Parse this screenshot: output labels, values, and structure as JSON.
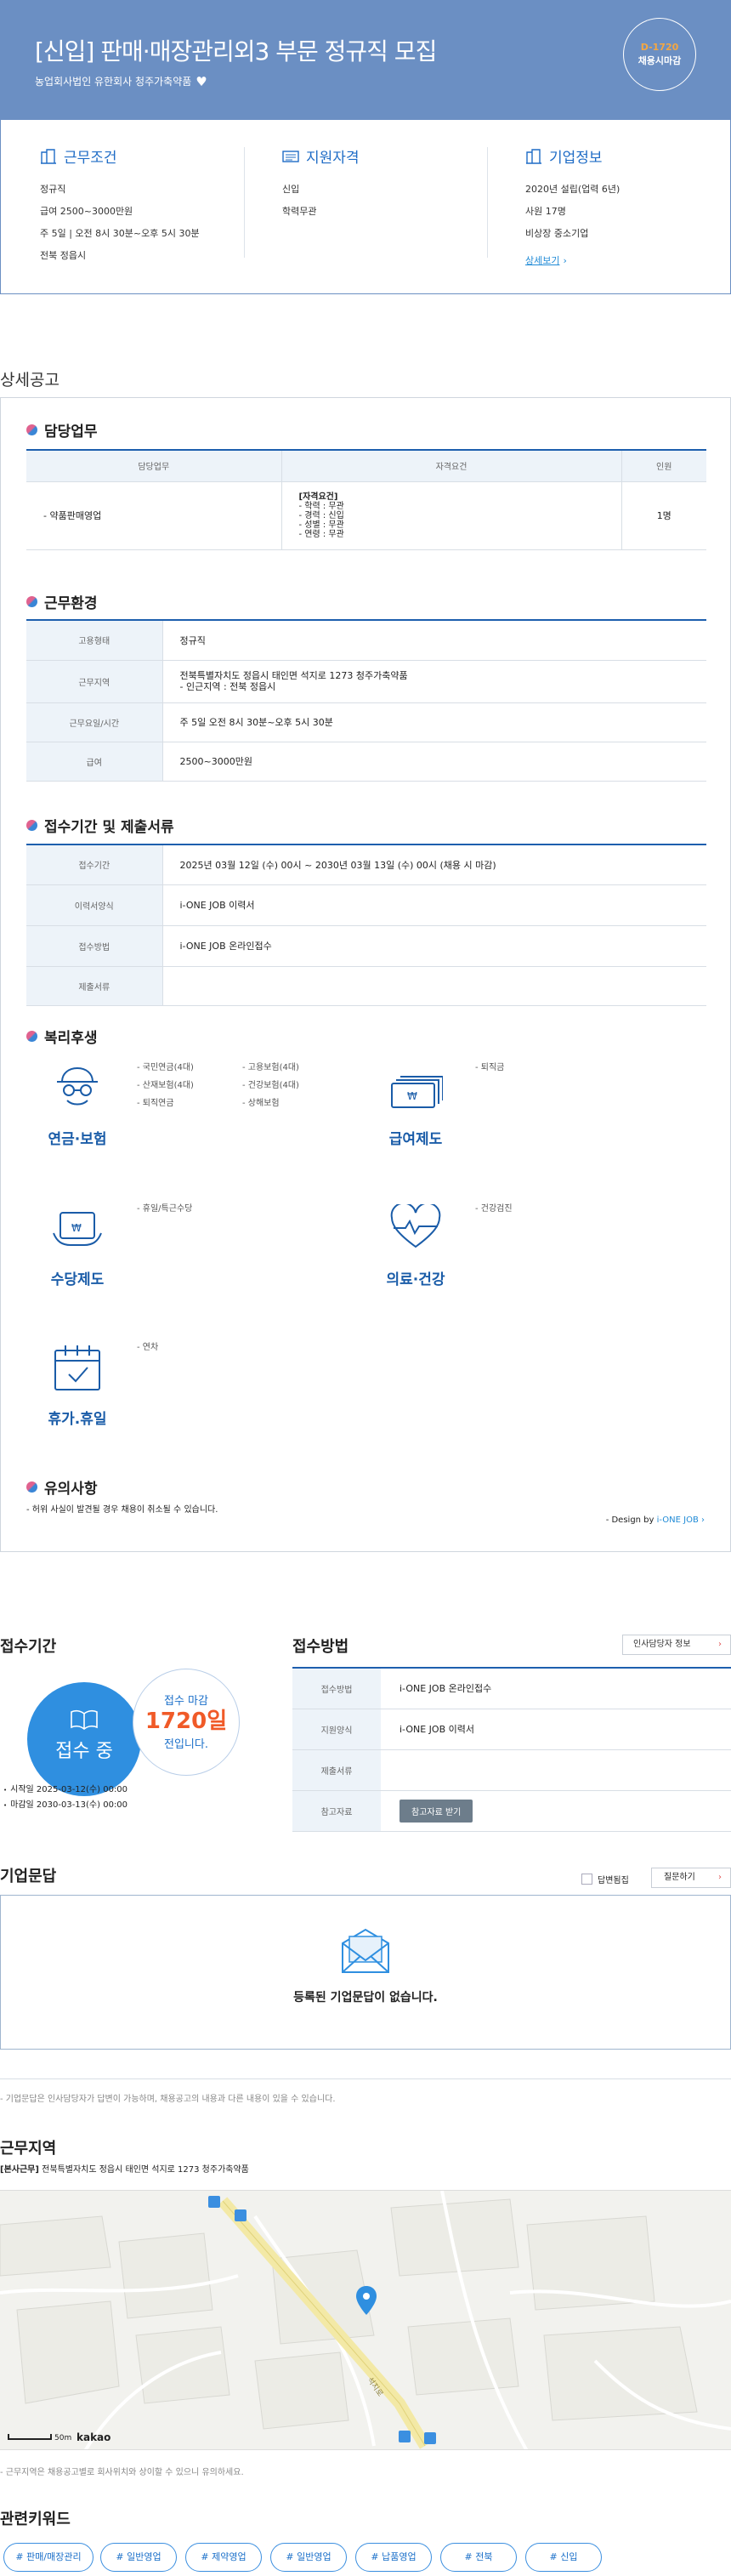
{
  "header": {
    "title": "[신입] 판매·매장관리외3 부문 정규직 모집",
    "company": "농업회사법인 유한회사 청주가축약품",
    "dday": "D-1720",
    "dday_sub": "채용시마감"
  },
  "summary": {
    "conditions": {
      "title": "근무조건",
      "items": [
        "정규직",
        "급여 2500~3000만원",
        "주 5일 | 오전 8시 30분~오후 5시 30분",
        "전북 정읍시"
      ]
    },
    "qualifications": {
      "title": "지원자격",
      "items": [
        "신입",
        "학력무관"
      ]
    },
    "company": {
      "title": "기업정보",
      "items": [
        "2020년 설립(업력 6년)",
        "사원 17명",
        "비상장 중소기업"
      ],
      "more": "상세보기"
    }
  },
  "detail": {
    "title": "상세공고",
    "duties": {
      "title": "담당업무",
      "headers": [
        "담당업무",
        "자격요건",
        "인원"
      ],
      "row": {
        "duty": "- 약품판매영업",
        "req_title": "[자격요건]",
        "reqs": [
          "- 학력 : 무관",
          "- 경력 : 신입",
          "- 성별 : 무관",
          "- 연령 : 무관"
        ],
        "count": "1명"
      }
    },
    "env": {
      "title": "근무환경",
      "rows": [
        {
          "k": "고용형태",
          "v": "정규직"
        },
        {
          "k": "근무지역",
          "v": "전북특별자치도 정읍시 태인면 석지로 1273 청주가축약품",
          "v2": "- 인근지역 : 전북 정읍시"
        },
        {
          "k": "근무요일/시간",
          "v": "주 5일 오전 8시 30분~오후 5시 30분"
        },
        {
          "k": "급여",
          "v": "2500~3000만원"
        }
      ]
    },
    "apply": {
      "title": "접수기간 및 제출서류",
      "rows": [
        {
          "k": "접수기간",
          "v": "2025년 03월 12일 (수) 00시 ~ 2030년 03월 13일 (수) 00시 (채용 시 마감)"
        },
        {
          "k": "이력서양식",
          "v": "i-ONE JOB 이력서"
        },
        {
          "k": "접수방법",
          "v": "i-ONE JOB 온라인접수"
        },
        {
          "k": "제출서류",
          "v": ""
        }
      ]
    },
    "welfare": {
      "title": "복리후생",
      "items": [
        {
          "name": "연금·보험",
          "icon": "pension-icon",
          "list": [
            "- 국민연금(4대)",
            "- 산재보험(4대)",
            "- 퇴직연금"
          ],
          "list2": [
            "- 고용보험(4대)",
            "- 건강보험(4대)",
            "- 상해보험"
          ]
        },
        {
          "name": "급여제도",
          "icon": "salary-icon",
          "list": [
            "- 퇴직금"
          ]
        },
        {
          "name": "수당제도",
          "icon": "allowance-icon",
          "list": [
            "- 휴일/특근수당"
          ]
        },
        {
          "name": "의료·건강",
          "icon": "health-icon",
          "list": [
            "- 건강검진"
          ]
        },
        {
          "name": "휴가.휴일",
          "icon": "vacation-icon",
          "list": [
            "- 연차"
          ]
        }
      ]
    },
    "notice": {
      "title": "유의사항",
      "text": "- 허위 사실이 발견될 경우 채용이 취소될 수 있습니다.",
      "design": "- Design by ",
      "design_link": "i-ONE JOB ›"
    }
  },
  "period": {
    "title": "접수기간",
    "status": "접수 중",
    "remain_label": "접수 마감",
    "remain_days": "1720일",
    "remain_suffix": "전입니다.",
    "start": "시작일 2025-03-12(수) 00:00",
    "end": "마감일 2030-03-13(수) 00:00"
  },
  "method": {
    "title": "접수방법",
    "contact_btn": "인사담당자 정보",
    "rows": [
      {
        "k": "접수방법",
        "v": "i-ONE JOB 온라인접수"
      },
      {
        "k": "지원양식",
        "v": "i-ONE JOB 이력서"
      },
      {
        "k": "제출서류",
        "v": ""
      },
      {
        "k": "참고자료",
        "v": "참고자료 받기"
      }
    ]
  },
  "qna": {
    "title": "기업문답",
    "answered": "답변됨집",
    "ask": "질문하기",
    "empty": "등록된 기업문답이 없습니다.",
    "note": "- 기업문답은 인사담당자가 답변이 가능하며, 채용공고의 내용과 다른 내용이 있을 수 있습니다."
  },
  "location": {
    "title": "근무지역",
    "tag": "[본사근무]",
    "address": "전북특별자치도 정읍시 태인면 석지로 1273 청주가축약품",
    "road": "석지로",
    "scale": "50m",
    "provider": "kakao",
    "note": "- 근무지역은 채용공고별로 회사위치와 상이할 수 있으니 유의하세요."
  },
  "keywords": {
    "title": "관련키워드",
    "items": [
      "# 판매/매장관리",
      "# 일반영업",
      "# 제약영업",
      "# 일반영업",
      "# 납품영업",
      "# 전북",
      "# 신입"
    ]
  },
  "colors": {
    "primary": "#6b8fc3",
    "accent": "#1f6cc6",
    "dday": "#f4a742",
    "orange": "#f05a28"
  }
}
